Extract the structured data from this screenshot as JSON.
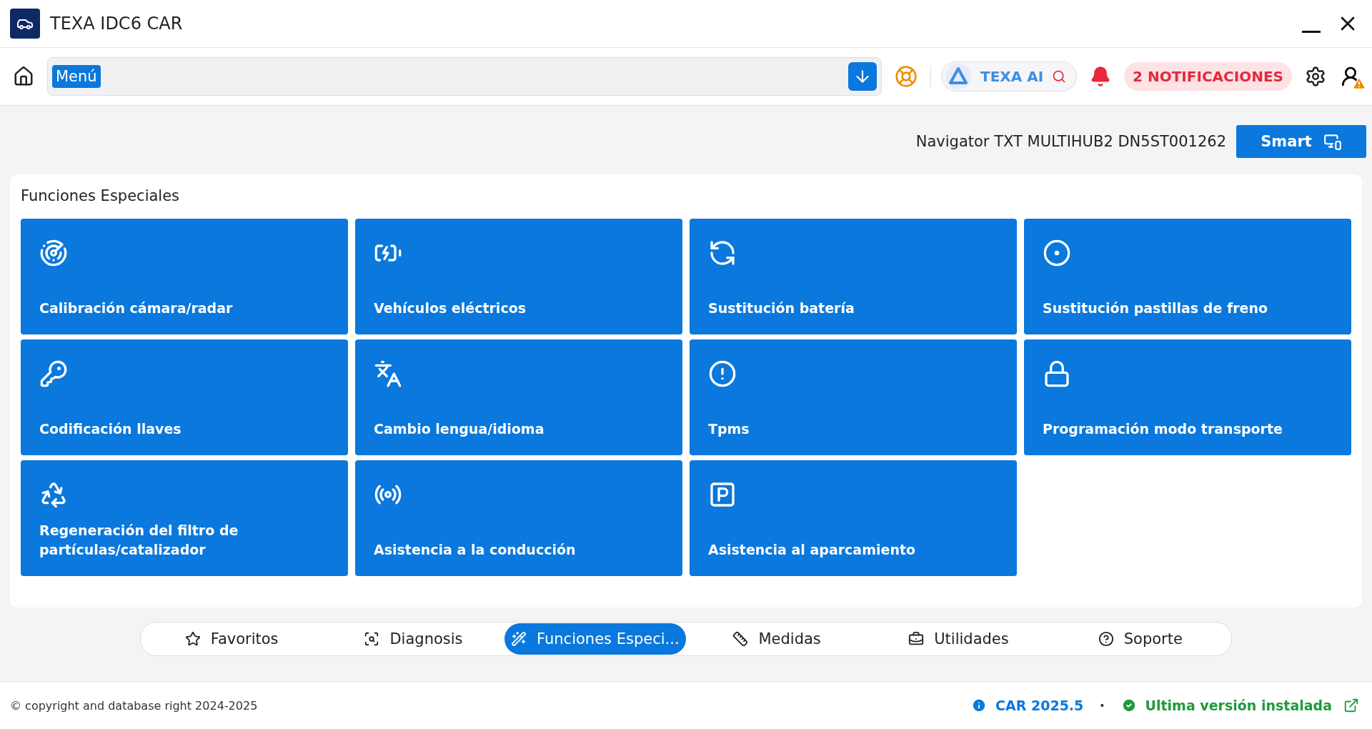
{
  "window": {
    "title": "TEXA IDC6 CAR"
  },
  "toolbar": {
    "menu_label": "Menú",
    "ai_label": "TEXA AI",
    "notifications": "2 NOTIFICACIONES"
  },
  "device": {
    "name": "Navigator TXT MULTIHUB2 DN5ST001262",
    "mode_button": "Smart"
  },
  "section": {
    "title": "Funciones Especiales",
    "tiles": [
      {
        "label": "Calibración cámara/radar"
      },
      {
        "label": "Vehículos eléctricos"
      },
      {
        "label": "Sustitución batería"
      },
      {
        "label": "Sustitución pastillas de freno"
      },
      {
        "label": "Codificación llaves"
      },
      {
        "label": "Cambio lengua/idioma"
      },
      {
        "label": "Tpms"
      },
      {
        "label": "Programación modo transporte"
      },
      {
        "label": "Regeneración del filtro de partículas/catalizador"
      },
      {
        "label": "Asistencia a la conducción"
      },
      {
        "label": "Asistencia al aparcamiento"
      }
    ]
  },
  "tabs": [
    {
      "label": "Favoritos",
      "selected": false
    },
    {
      "label": "Diagnosis",
      "selected": false
    },
    {
      "label": "Funciones Especi...",
      "selected": true
    },
    {
      "label": "Medidas",
      "selected": false
    },
    {
      "label": "Utilidades",
      "selected": false
    },
    {
      "label": "Soporte",
      "selected": false
    }
  ],
  "footer": {
    "copyright": "© copyright and database right 2024-2025",
    "version": "CAR 2025.5",
    "separator": "•",
    "status": "Ultima versión instalada"
  }
}
